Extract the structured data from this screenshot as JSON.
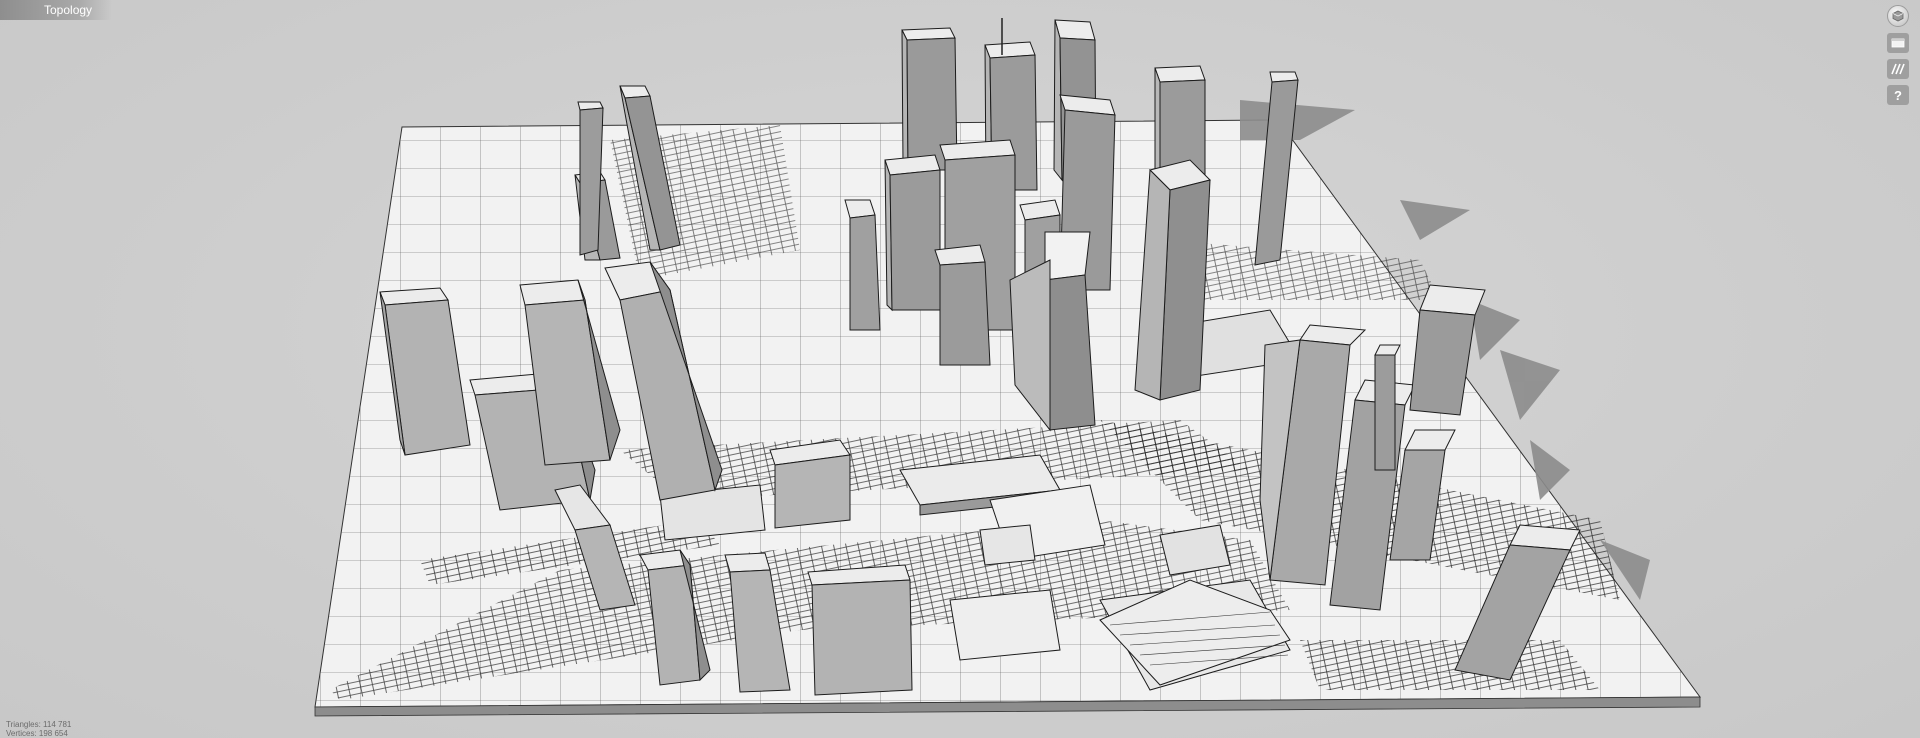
{
  "mode_tab": {
    "label": "Topology"
  },
  "toolbar": {
    "buttons": [
      {
        "name": "navigation-cube-button",
        "icon": "cube-icon"
      },
      {
        "name": "display-mode-button",
        "icon": "window-icon"
      },
      {
        "name": "wireframe-toggle-button",
        "icon": "stripes-icon"
      },
      {
        "name": "help-button",
        "icon": "help-icon",
        "label": "?"
      }
    ]
  },
  "stats": {
    "triangles": "Triangles: 114 781",
    "vertices": "Vertices: 198 654"
  },
  "colors": {
    "background": "#cfcfcf",
    "ground": "#f1f1f1",
    "building_top": "#e9e9e9",
    "building_left": "#b3b3b3",
    "building_right": "#929292",
    "shadow": "#8a8a8a",
    "edge": "#1c1c1c"
  }
}
